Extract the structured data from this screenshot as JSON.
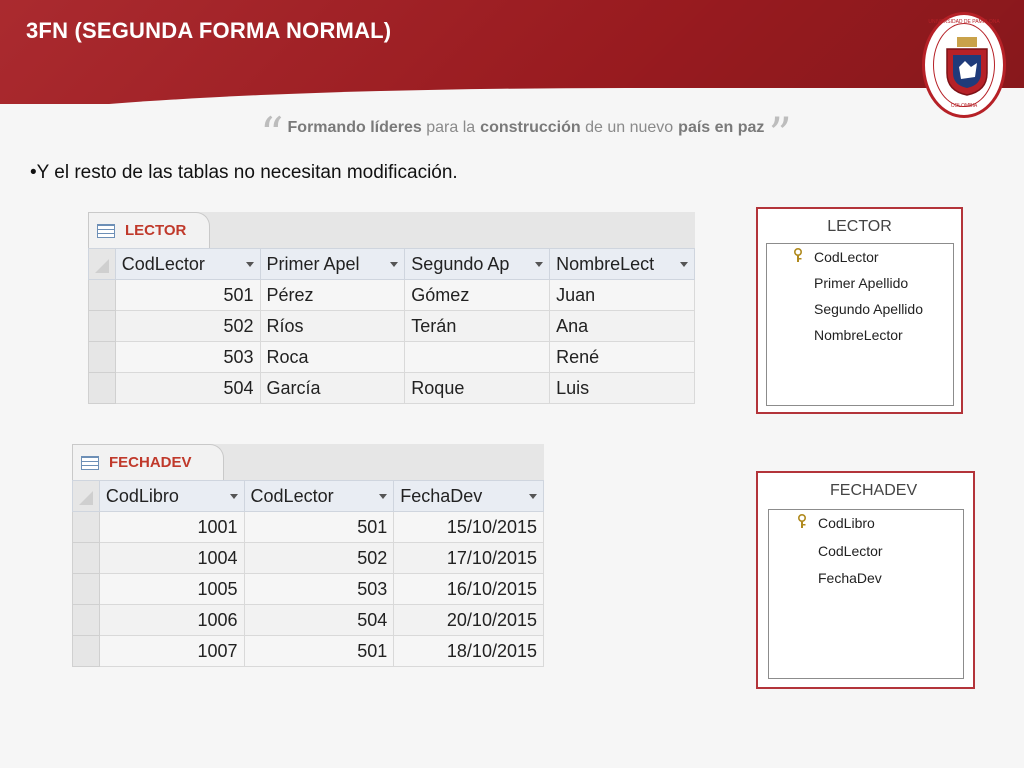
{
  "slide": {
    "title": "3FN (SEGUNDA FORMA NORMAL)",
    "bullet": "•Y el resto de las tablas no necesitan modificación."
  },
  "slogan": {
    "open_quote": "“",
    "close_quote": "”",
    "w1": "Formando",
    "w2": "líderes",
    "w3": "para la",
    "w4": "construcción",
    "w5": "de un nuevo",
    "w6": "país en paz"
  },
  "logo": {
    "top_text": "UNIVERSIDAD DE PAMPLONA",
    "bottom_text": "COLOMBIA"
  },
  "colors": {
    "header": "#a51d22",
    "accent": "#b3343a",
    "tab_text": "#c0392b"
  },
  "lector_sheet": {
    "tab": "LECTOR",
    "columns": [
      "CodLector",
      "Primer Apel",
      "Segundo Ap",
      "NombreLect"
    ],
    "rows": [
      [
        "501",
        "Pérez",
        "Gómez",
        "Juan"
      ],
      [
        "502",
        "Ríos",
        "Terán",
        "Ana"
      ],
      [
        "503",
        "Roca",
        "",
        "René"
      ],
      [
        "504",
        "García",
        "Roque",
        "Luis"
      ]
    ]
  },
  "fechadev_sheet": {
    "tab": "FECHADEV",
    "columns": [
      "CodLibro",
      "CodLector",
      "FechaDev"
    ],
    "rows": [
      [
        "1001",
        "501",
        "15/10/2015"
      ],
      [
        "1004",
        "502",
        "17/10/2015"
      ],
      [
        "1005",
        "503",
        "16/10/2015"
      ],
      [
        "1006",
        "504",
        "20/10/2015"
      ],
      [
        "1007",
        "501",
        "18/10/2015"
      ]
    ]
  },
  "lector_schema": {
    "title": "LECTOR",
    "fields": [
      "CodLector",
      "Primer Apellido",
      "Segundo Apellido",
      "NombreLector"
    ],
    "key_icon": "key-icon"
  },
  "fechadev_schema": {
    "title": "FECHADEV",
    "fields": [
      "CodLibro",
      "CodLector",
      "FechaDev"
    ],
    "key_icon": "key-icon"
  }
}
